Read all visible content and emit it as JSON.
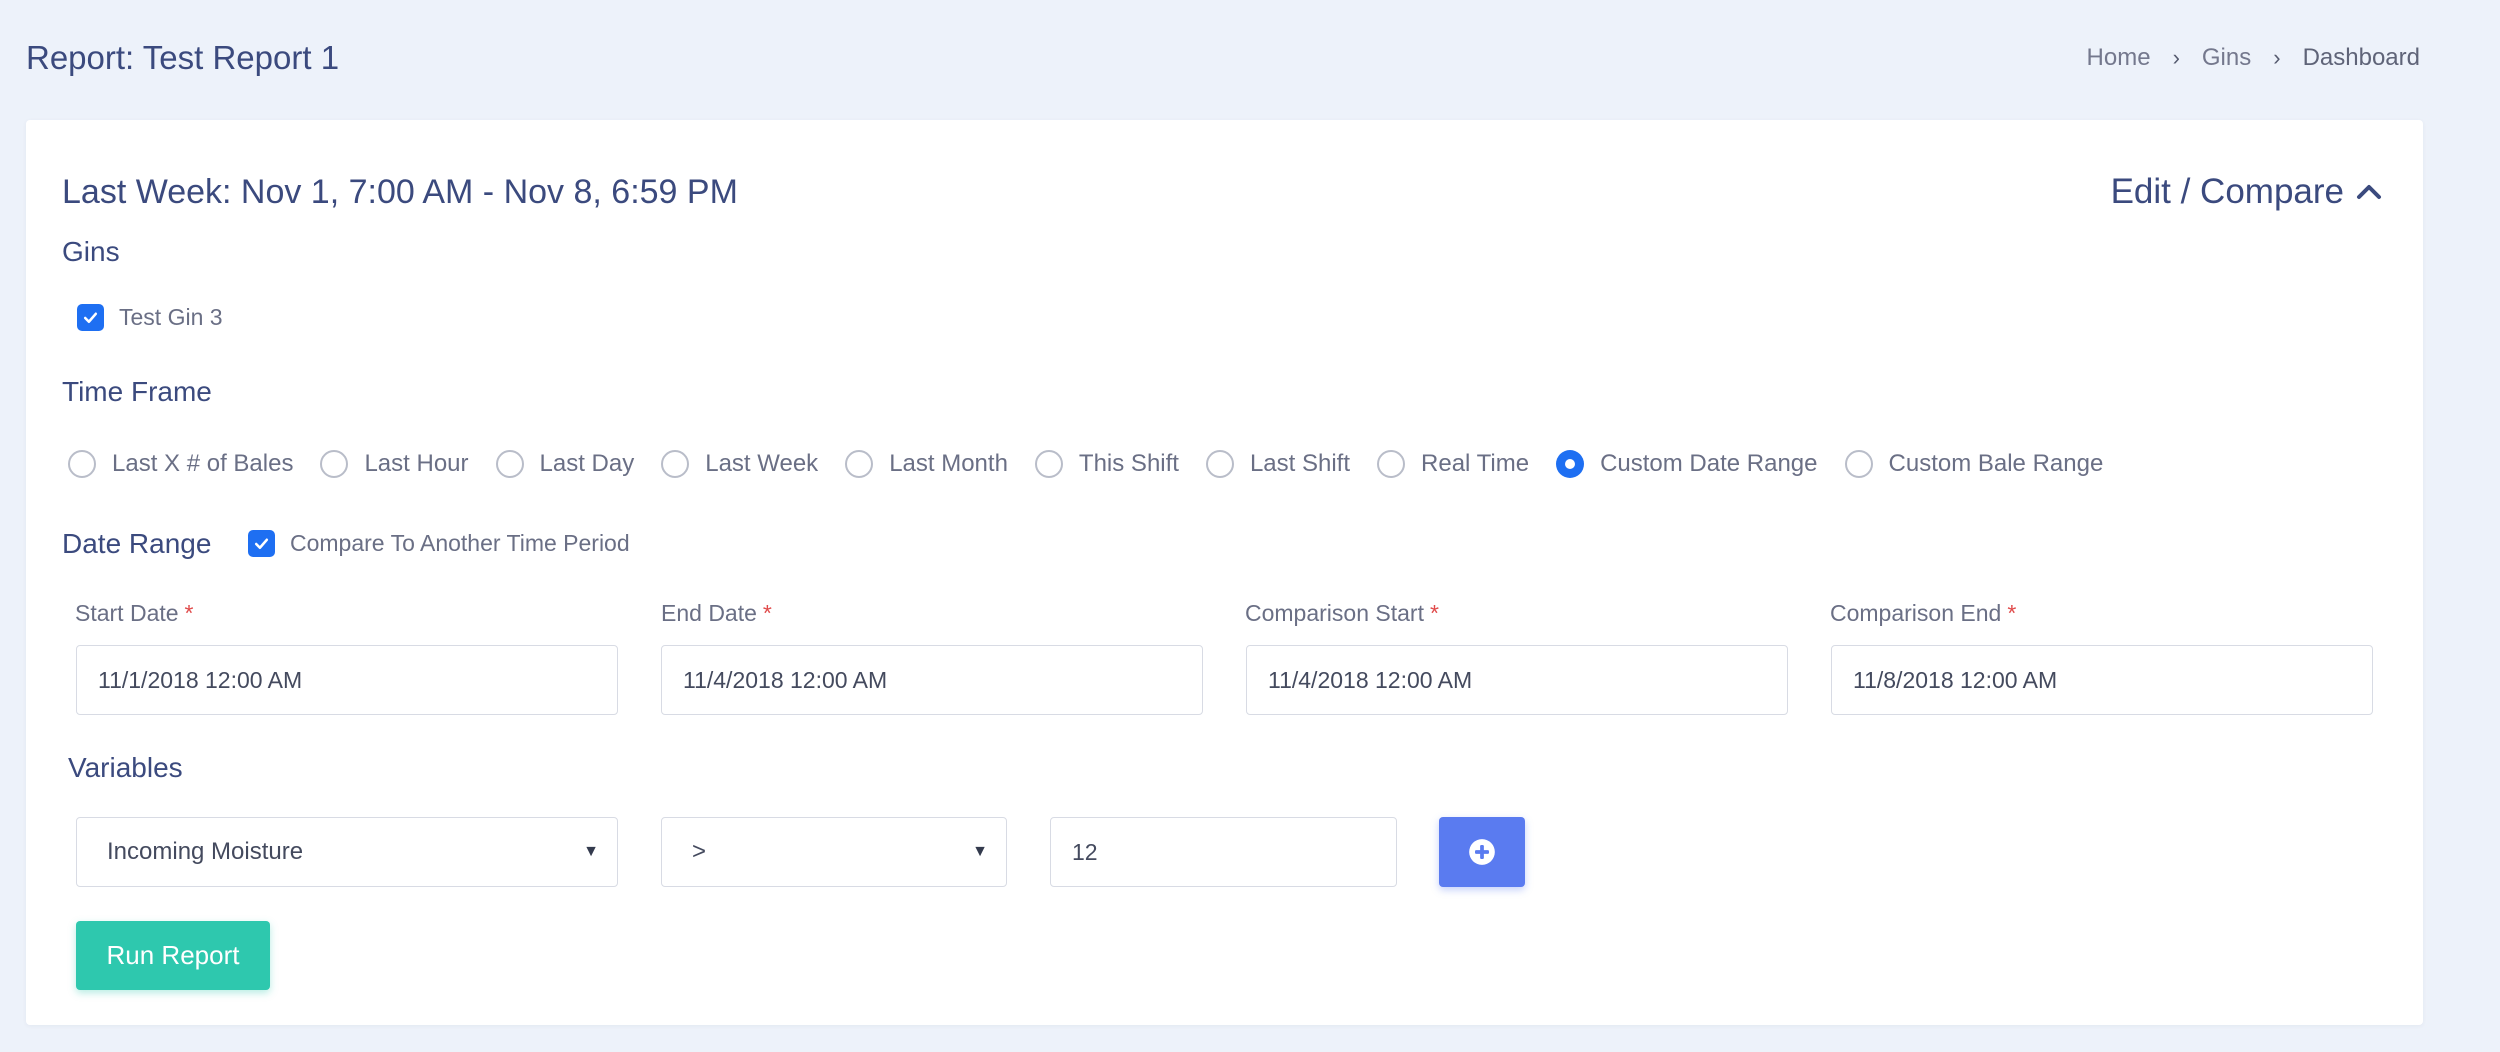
{
  "header": {
    "title": "Report: Test Report 1",
    "breadcrumb": [
      "Home",
      "Gins",
      "Dashboard"
    ]
  },
  "card": {
    "range_title": "Last Week: Nov 1, 7:00 AM - Nov 8, 6:59 PM",
    "edit_label": "Edit / Compare"
  },
  "gins": {
    "label": "Gins",
    "items": [
      {
        "label": "Test Gin 3",
        "checked": true
      }
    ]
  },
  "time_frame": {
    "label": "Time Frame",
    "options": [
      "Last X # of Bales",
      "Last Hour",
      "Last Day",
      "Last Week",
      "Last Month",
      "This Shift",
      "Last Shift",
      "Real Time",
      "Custom Date Range",
      "Custom Bale Range"
    ],
    "selected": "Custom Date Range"
  },
  "date_range": {
    "label": "Date Range",
    "compare_label": "Compare To Another Time Period",
    "compare_checked": true,
    "fields": [
      {
        "label": "Start Date",
        "value": "11/1/2018 12:00 AM"
      },
      {
        "label": "End Date",
        "value": "11/4/2018 12:00 AM"
      },
      {
        "label": "Comparison Start",
        "value": "11/4/2018 12:00 AM"
      },
      {
        "label": "Comparison End",
        "value": "11/8/2018 12:00 AM"
      }
    ],
    "required_mark": "*"
  },
  "variables": {
    "label": "Variables",
    "variable": "Incoming Moisture",
    "operator": ">",
    "value": "12"
  },
  "actions": {
    "run_label": "Run Report"
  },
  "colors": {
    "primary": "#1e6ff2",
    "add_button": "#5a7bf0",
    "run_button": "#2ec8ae",
    "required": "#e04b4b",
    "background": "#edf2fa"
  }
}
